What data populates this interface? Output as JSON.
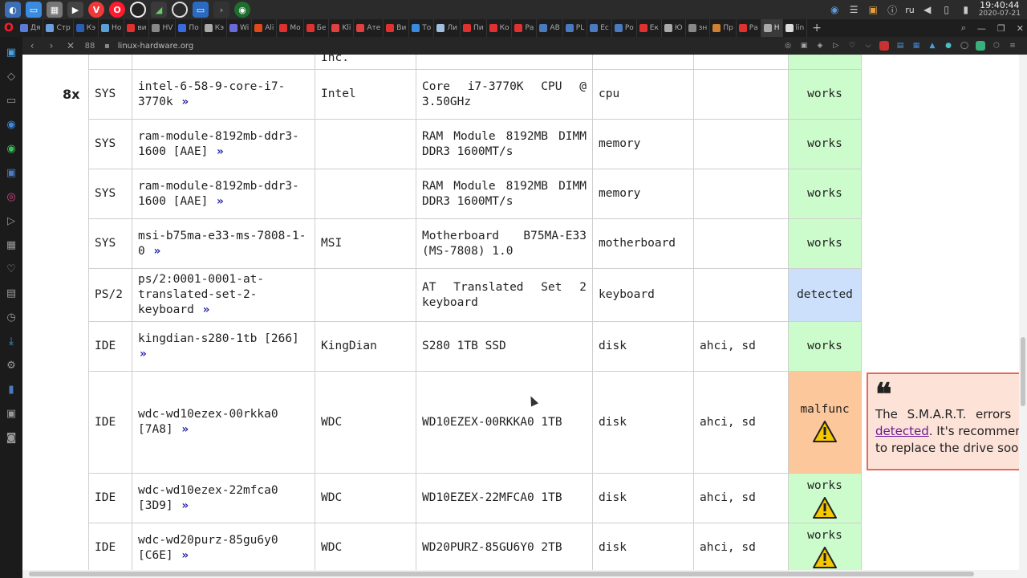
{
  "taskbar": {
    "tray": {
      "language": "ru",
      "time": "19:40:44",
      "date": "2020-07-21"
    }
  },
  "browser": {
    "logo": "O",
    "tabs": [
      {
        "label": "Дя",
        "color": "#5a7bd8"
      },
      {
        "label": "Стр",
        "color": "#6aa0e0"
      },
      {
        "label": "Кэ",
        "color": "#2b5fb5"
      },
      {
        "label": "Но",
        "color": "#5aa0d8"
      },
      {
        "label": "ви",
        "color": "#e03030"
      },
      {
        "label": "HV",
        "color": "#888"
      },
      {
        "label": "По",
        "color": "#3a6ae0"
      },
      {
        "label": "Кэ",
        "color": "#aaa"
      },
      {
        "label": "Wi",
        "color": "#6a6ad8"
      },
      {
        "label": "Ali",
        "color": "#e04a1a"
      },
      {
        "label": "Мо",
        "color": "#e03030"
      },
      {
        "label": "Бе",
        "color": "#e03030"
      },
      {
        "label": "Kli",
        "color": "#e04040"
      },
      {
        "label": "Ате",
        "color": "#e04040"
      },
      {
        "label": "Ви",
        "color": "#e03030"
      },
      {
        "label": "То",
        "color": "#3a8ae0"
      },
      {
        "label": "Ли",
        "color": "#a0c0e0"
      },
      {
        "label": "Пи",
        "color": "#e03030"
      },
      {
        "label": "Ко",
        "color": "#e03030"
      },
      {
        "label": "Ра",
        "color": "#e03030"
      },
      {
        "label": "AB",
        "color": "#4a7ac0"
      },
      {
        "label": "PL",
        "color": "#4a7ac0"
      },
      {
        "label": "Ес",
        "color": "#4a7ac0"
      },
      {
        "label": "Ро",
        "color": "#4a7ac0"
      },
      {
        "label": "Ек",
        "color": "#e03030"
      },
      {
        "label": "Ю",
        "color": "#aaa"
      },
      {
        "label": "зн",
        "color": "#888"
      },
      {
        "label": "Пр",
        "color": "#d08030"
      },
      {
        "label": "Ра",
        "color": "#e03030"
      },
      {
        "label": "H",
        "color": "#aaa",
        "active": true
      },
      {
        "label": "lin",
        "color": "#ddd"
      }
    ],
    "new_tab": "+",
    "nav": {
      "back": "‹",
      "forward": "›",
      "stop": "✕",
      "speed_dial": "88"
    },
    "url": "linux-hardware.org"
  },
  "page": {
    "count": "8x",
    "top_partial_vendor": "Inc.",
    "more_glyph": "»",
    "rows": [
      {
        "bus": "SYS",
        "id": "intel-6-58-9-core-i7-3770k",
        "vendor": "Intel",
        "device": "Core i7-3770K CPU @ 3.50GHz",
        "type": "cpu",
        "driver": "",
        "status": "works",
        "status_class": "works",
        "warn": false,
        "h": 62
      },
      {
        "bus": "SYS",
        "id": "ram-module-8192mb-ddr3-1600 [AAE]",
        "vendor": "",
        "device": "RAM Module 8192MB DIMM DDR3 1600MT/s",
        "type": "memory",
        "driver": "",
        "status": "works",
        "status_class": "works",
        "warn": false,
        "h": 62
      },
      {
        "bus": "SYS",
        "id": "ram-module-8192mb-ddr3-1600 [AAE]",
        "vendor": "",
        "device": "RAM Module 8192MB DIMM DDR3 1600MT/s",
        "type": "memory",
        "driver": "",
        "status": "works",
        "status_class": "works",
        "warn": false,
        "h": 62
      },
      {
        "bus": "SYS",
        "id": "msi-b75ma-e33-ms-7808-1-0",
        "vendor": "MSI",
        "device": "Motherboard B75MA-E33 (MS-7808) 1.0",
        "type": "motherboard",
        "driver": "",
        "status": "works",
        "status_class": "works",
        "warn": false,
        "h": 62
      },
      {
        "bus": "PS/2",
        "id": "ps/2:0001-0001-at-translated-set-2-keyboard",
        "vendor": "",
        "device": "AT Translated Set 2 keyboard",
        "type": "keyboard",
        "driver": "",
        "status": "detected",
        "status_class": "detected",
        "warn": false,
        "h": 66
      },
      {
        "bus": "IDE",
        "id": "kingdian-s280-1tb [266]",
        "vendor": "KingDian",
        "device": "S280 1TB SSD",
        "type": "disk",
        "driver": "ahci, sd",
        "status": "works",
        "status_class": "works",
        "warn": false,
        "h": 62
      },
      {
        "bus": "IDE",
        "id": "wdc-wd10ezex-00rkka0 [7A8]",
        "vendor": "WDC",
        "device": "WD10EZEX-00RKKA0 1TB",
        "type": "disk",
        "driver": "ahci, sd",
        "status": "malfunc",
        "status_class": "malfunc",
        "warn": true,
        "h": 127
      },
      {
        "bus": "IDE",
        "id": "wdc-wd10ezex-22mfca0 [3D9]",
        "vendor": "WDC",
        "device": "WD10EZEX-22MFCA0 1TB",
        "type": "disk",
        "driver": "ahci, sd",
        "status": "works",
        "status_class": "works",
        "warn": true,
        "h": 62
      },
      {
        "bus": "IDE",
        "id": "wdc-wd20purz-85gu6y0 [C6E]",
        "vendor": "WDC",
        "device": "WD20PURZ-85GU6Y0 2TB",
        "type": "disk",
        "driver": "ahci, sd",
        "status": "works",
        "status_class": "works",
        "warn": true,
        "h": 62
      }
    ],
    "smart_note": {
      "quote": "❝",
      "line1": "The S.M.A.R.T. errors",
      "link": "detected",
      "line2_rest": ". It's recommen",
      "line3": "to replace the drive soon"
    }
  }
}
